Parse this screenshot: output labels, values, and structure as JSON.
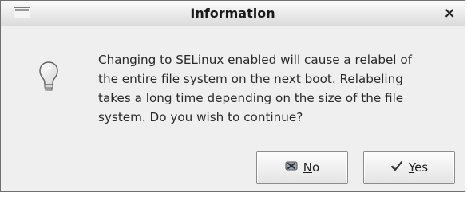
{
  "window": {
    "title": "Information",
    "close_glyph": "×"
  },
  "dialog": {
    "icon": "lightbulb-icon",
    "message": "Changing to SELinux enabled will cause a relabel of\nthe entire file system on the next boot. Relabeling\ntakes a long time depending on the size of the file\nsystem.  Do you wish to continue?"
  },
  "buttons": {
    "no": {
      "mnemonic": "N",
      "rest": "o",
      "icon": "no-icon"
    },
    "yes": {
      "mnemonic": "Y",
      "rest": "es",
      "icon": "yes-icon"
    }
  },
  "colors": {
    "dialog_bg": "#efefef",
    "titlebar_top": "#fbfbfb",
    "titlebar_bottom": "#dcdcdc",
    "text": "#2a2a2a"
  }
}
